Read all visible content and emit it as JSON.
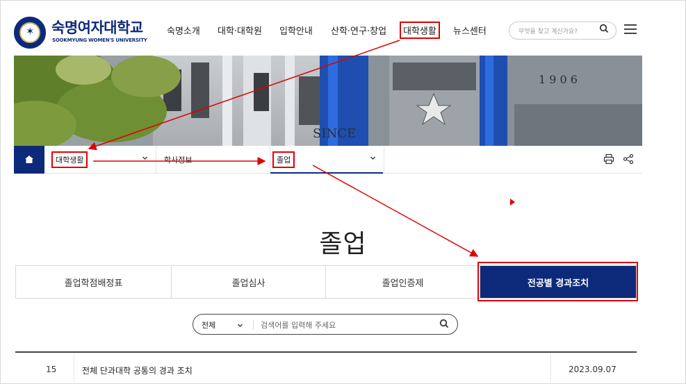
{
  "header": {
    "brand_name": "숙명여자대학교",
    "brand_sub": "SOOKMYUNG WOMEN'S UNIVERSITY",
    "nav": [
      {
        "label": "숙명소개",
        "highlighted": false
      },
      {
        "label": "대학·대학원",
        "highlighted": false
      },
      {
        "label": "입학안내",
        "highlighted": false
      },
      {
        "label": "산학·연구·창업",
        "highlighted": false
      },
      {
        "label": "대학생활",
        "highlighted": true
      },
      {
        "label": "뉴스센터",
        "highlighted": false
      }
    ],
    "search_placeholder": "무엇을 찾고 계신가요?"
  },
  "banner": {
    "building_text": "SINCE",
    "year_text": "1 9 0 6"
  },
  "breadcrumb": {
    "items": [
      {
        "label": "대학생활",
        "highlighted": true
      },
      {
        "label": "학사정보",
        "highlighted": false
      },
      {
        "label": "졸업",
        "highlighted": true
      }
    ]
  },
  "page": {
    "title": "졸업"
  },
  "tabs": [
    {
      "label": "졸업학점배정표",
      "active": false
    },
    {
      "label": "졸업심사",
      "active": false
    },
    {
      "label": "졸업인증제",
      "active": false
    },
    {
      "label": "전공별 경과조치",
      "active": true
    }
  ],
  "search": {
    "category": "전체",
    "placeholder": "검색어를 입력해 주세요"
  },
  "list": [
    {
      "num": "15",
      "title": "전체 단과대학 공통의 경과 조치",
      "date": "2023.09.07"
    }
  ],
  "colors": {
    "brand": "#0d2a7a",
    "annotation": "#e00000"
  }
}
